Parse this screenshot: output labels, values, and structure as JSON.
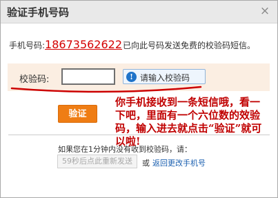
{
  "dialog": {
    "title": "验证手机号码",
    "close_glyph": "×"
  },
  "phone": {
    "prefix": "手机号码:",
    "number": "18673562622",
    "suffix": "已向此号码发送免费的校验码短信。"
  },
  "code": {
    "label": "校验码:",
    "value": "",
    "hint": "请输入校验码",
    "hint_icon": "!"
  },
  "verify_button": "验证",
  "annotation": "你手机接收到一条短信哦，看一下吧，里面有一个六位数的效验码，输入进去就点击“验证”就可以啦!",
  "resend": {
    "info": "如果您在1分钟内没有收到校验码，请：",
    "button": "59秒后点此重新发送",
    "or": "或",
    "back_link": "返回更改手机号"
  },
  "colors": {
    "accent": "#ef7d14",
    "annotation_red": "#c00000",
    "number_red": "#d40000",
    "link_blue": "#1a5fb0"
  }
}
